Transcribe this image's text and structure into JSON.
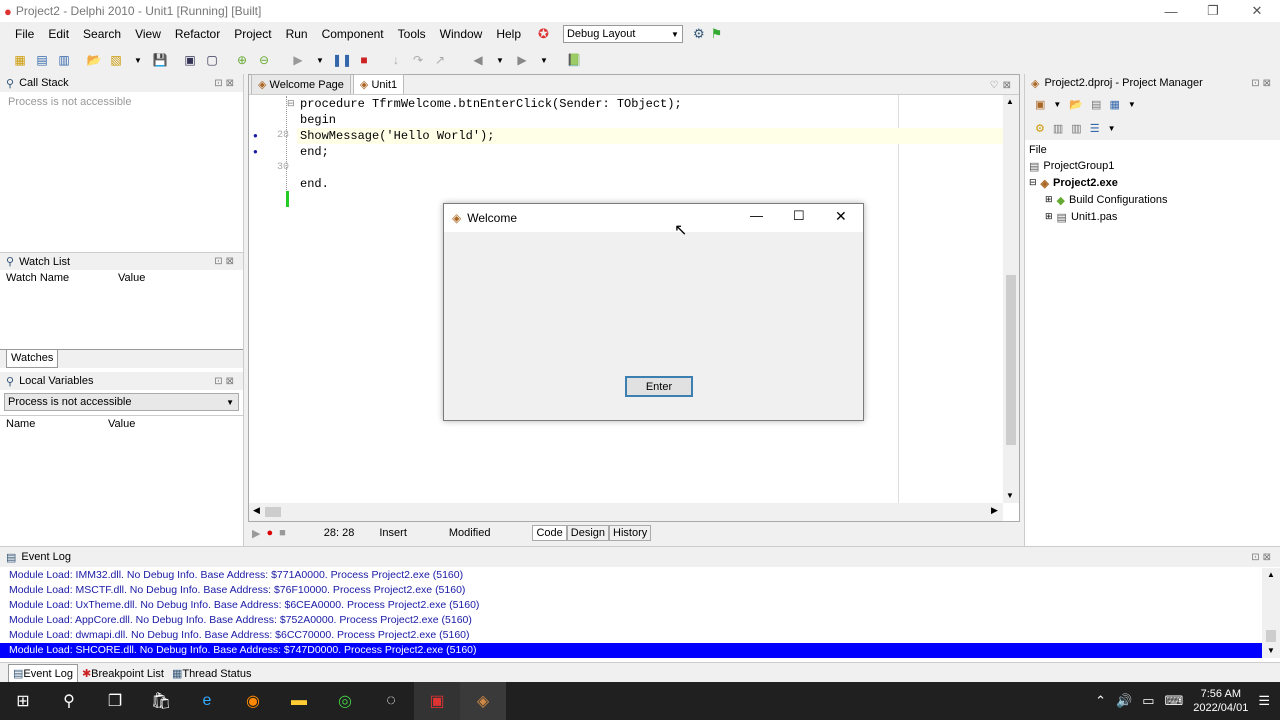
{
  "window": {
    "title": "Project2 - Delphi 2010 - Unit1 [Running] [Built]"
  },
  "menu": [
    "File",
    "Edit",
    "Search",
    "View",
    "Refactor",
    "Project",
    "Run",
    "Component",
    "Tools",
    "Window",
    "Help"
  ],
  "toolbar": {
    "layout_select": "Debug Layout"
  },
  "callstack": {
    "title": "Call Stack",
    "message": "Process is not accessible"
  },
  "watchlist": {
    "title": "Watch List",
    "col_name": "Watch Name",
    "col_value": "Value",
    "tab": "Watches"
  },
  "localvars": {
    "title": "Local Variables",
    "select": "Process is not accessible",
    "col_name": "Name",
    "col_value": "Value"
  },
  "editor": {
    "tabs": [
      "Welcome Page",
      "Unit1"
    ],
    "lines": [
      {
        "num": "",
        "text": "procedure TfrmWelcome.btnEnterClick(Sender: TObject);"
      },
      {
        "num": "",
        "text": "begin"
      },
      {
        "num": "28",
        "text": "ShowMessage('Hello World');"
      },
      {
        "num": "",
        "text": "end;"
      },
      {
        "num": "30",
        "text": ""
      },
      {
        "num": "",
        "text": "end."
      }
    ],
    "status_pos": "28: 28",
    "status_mode": "Insert",
    "status_mod": "Modified",
    "bottom_tabs": [
      "Code",
      "Design",
      "History"
    ]
  },
  "dialog": {
    "title": "Welcome",
    "button": "Enter"
  },
  "project": {
    "title": "Project2.dproj - Project Manager",
    "file_label": "File",
    "group": "ProjectGroup1",
    "exe": "Project2.exe",
    "build": "Build Configurations",
    "unit": "Unit1.pas"
  },
  "eventlog": {
    "title": "Event Log",
    "lines": [
      "Module Load: IMM32.dll. No Debug Info. Base Address: $771A0000. Process Project2.exe (5160)",
      "Module Load: MSCTF.dll. No Debug Info. Base Address: $76F10000. Process Project2.exe (5160)",
      "Module Load: UxTheme.dll. No Debug Info. Base Address: $6CEA0000. Process Project2.exe (5160)",
      "Module Load: AppCore.dll. No Debug Info. Base Address: $752A0000. Process Project2.exe (5160)",
      "Module Load: dwmapi.dll. No Debug Info. Base Address: $6CC70000. Process Project2.exe (5160)",
      "Module Load: SHCORE.dll. No Debug Info. Base Address: $747D0000. Process Project2.exe (5160)"
    ],
    "tabs": [
      "Event Log",
      "Breakpoint List",
      "Thread Status"
    ]
  },
  "taskbar": {
    "time": "7:56 AM",
    "date": "2022/04/01"
  },
  "colors": {
    "selection": "#0000ff",
    "link": "#1a1aa6",
    "taskbar": "#202020"
  }
}
